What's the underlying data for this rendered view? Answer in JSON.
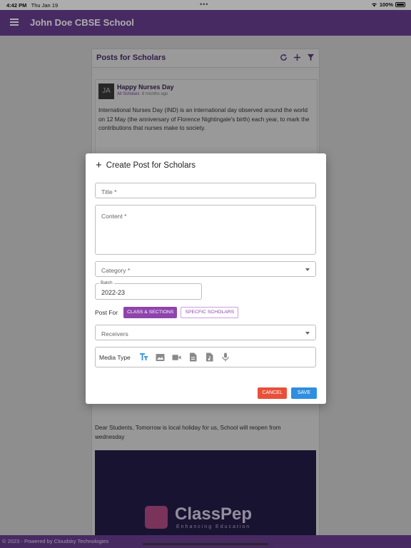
{
  "status_bar": {
    "time": "4:42 PM",
    "date": "Thu Jan 19",
    "battery": "100%"
  },
  "app_bar": {
    "title": "John Doe CBSE School"
  },
  "panel": {
    "title": "Posts for Scholars",
    "post": {
      "avatar_initials": "JA",
      "title": "Happy Nurses Day",
      "audience": "All Scholars",
      "age": "8 months ago",
      "body": "International Nurses Day (IND) is an international day observed around the world on 12 May (the anniversary of Florence Nightingale's birth) each year, to mark the contributions that nurses make to society."
    },
    "post2": {
      "body": "Dear Students, Tomorrow is local holiday for us, School will reopen from wednesday",
      "banner_brand": "ClassPep",
      "banner_tagline": "Enhancing Education"
    }
  },
  "footer": {
    "text": "© 2023 - Powered by Cloudsky Technologies"
  },
  "dialog": {
    "title": "Create Post for Scholars",
    "title_placeholder": "Title *",
    "content_placeholder": "Content *",
    "category_placeholder": "Category *",
    "batch_label": "Batch",
    "batch_value": "2022-23",
    "post_for_label": "Post For",
    "post_for_options": [
      "CLASS & SECTIONS",
      "SPECFIC SCHOLARS"
    ],
    "receivers_placeholder": "Receivers",
    "media_type_label": "Media Type",
    "media_icons": [
      "text-icon",
      "image-icon",
      "video-icon",
      "document-icon",
      "audio-file-icon",
      "microphone-icon"
    ],
    "cancel_label": "CANCEL",
    "save_label": "SAVE"
  },
  "colors": {
    "primary": "#6a3f92",
    "chip_active": "#8e44ad",
    "cancel": "#e8503a",
    "save": "#2f8fde"
  }
}
